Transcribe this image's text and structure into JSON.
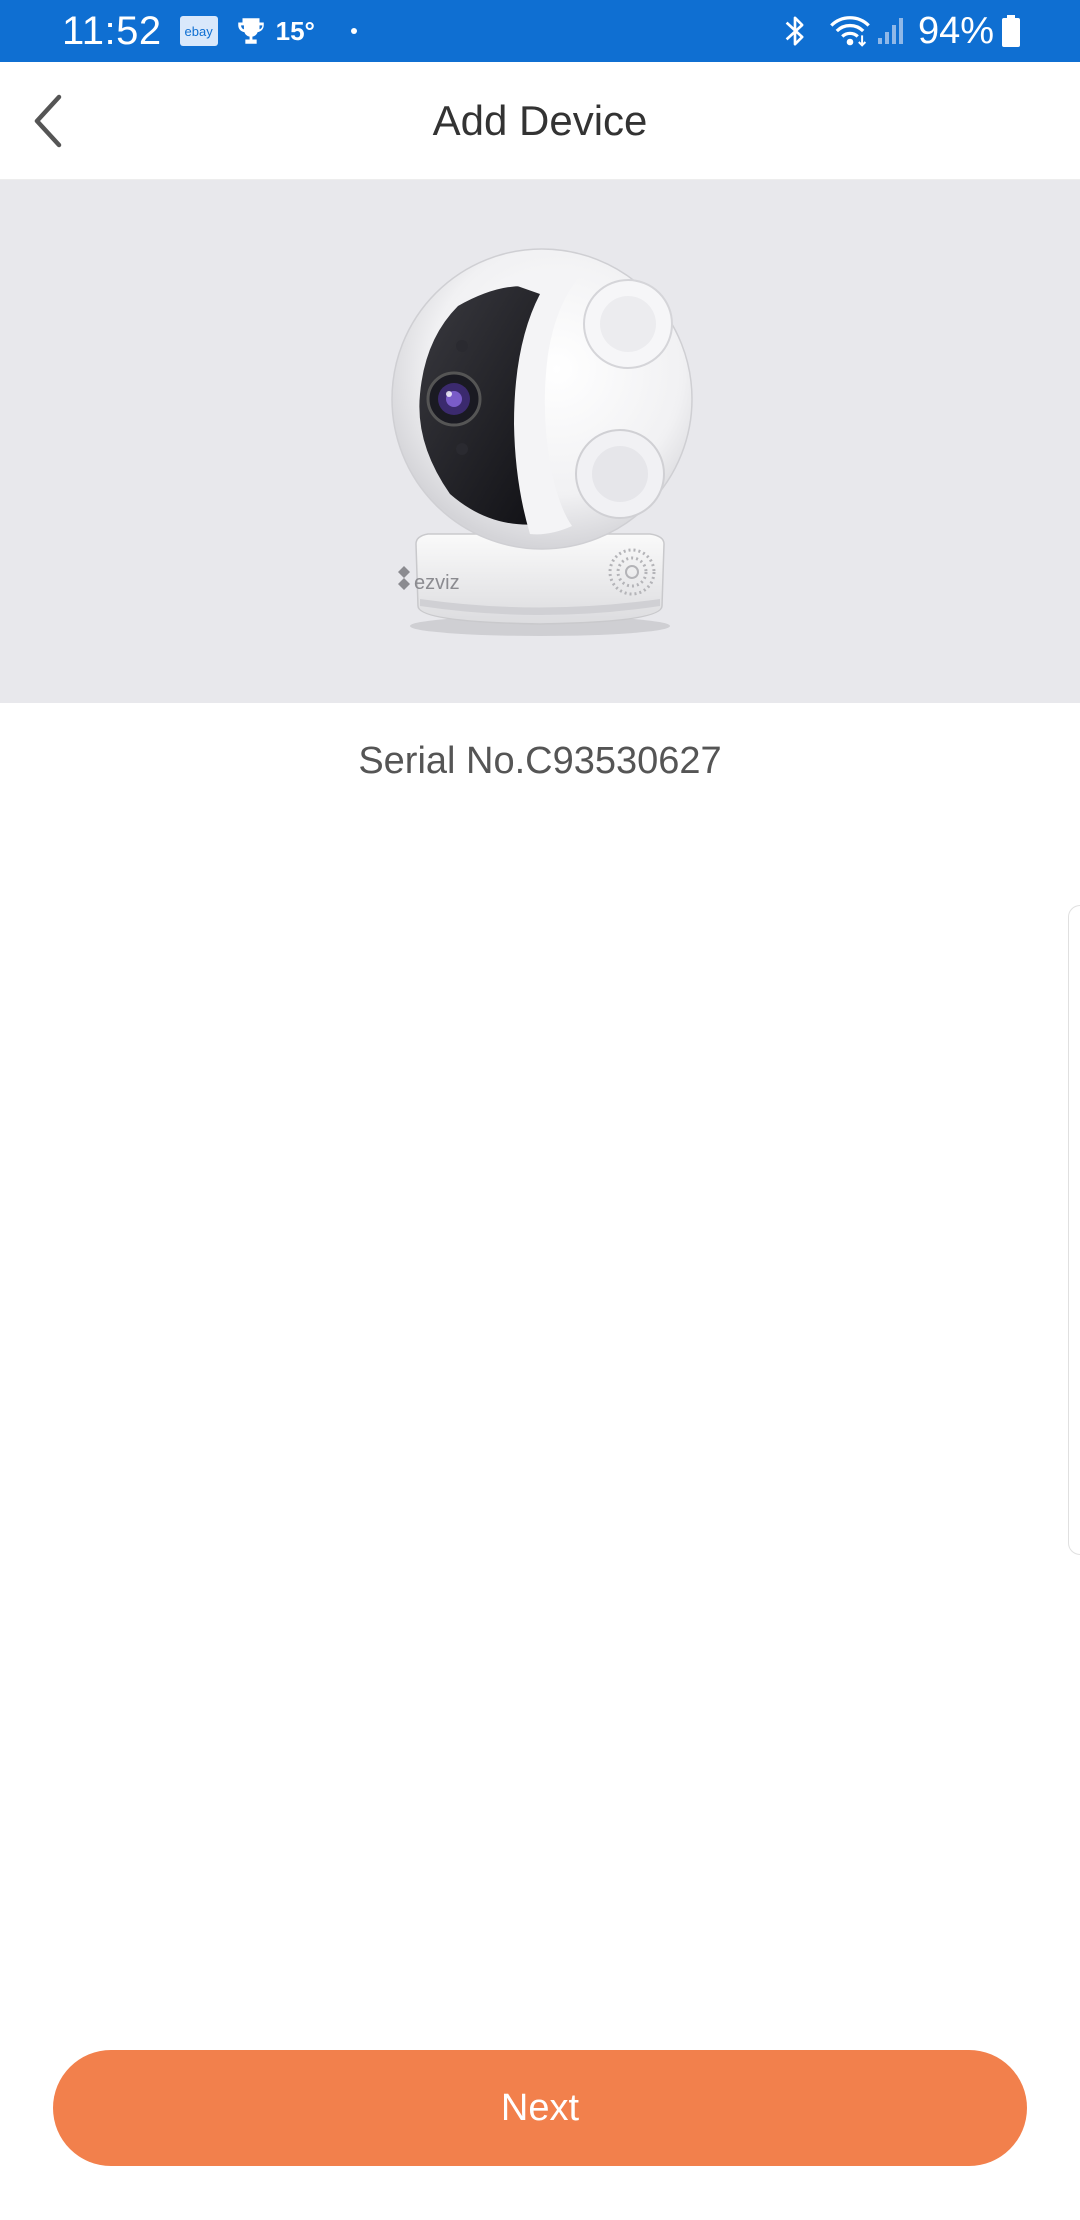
{
  "status_bar": {
    "time": "11:52",
    "notification_icons": [
      "ebay-icon",
      "trophy-icon"
    ],
    "ebay_label": "ebay",
    "temperature": "15°",
    "battery": "94%",
    "system_icons": [
      "bluetooth-icon",
      "wifi-icon",
      "signal-icon",
      "battery-icon"
    ]
  },
  "header": {
    "title": "Add Device",
    "back_icon": "chevron-left-icon"
  },
  "device": {
    "serial_number": "Serial No.C93530627",
    "brand_logo": "ezviz"
  },
  "actions": {
    "next_label": "Next"
  },
  "colors": {
    "status_bar": "#0f6fd2",
    "accent": "#f2804c",
    "device_panel_bg": "#e8e8ec"
  }
}
